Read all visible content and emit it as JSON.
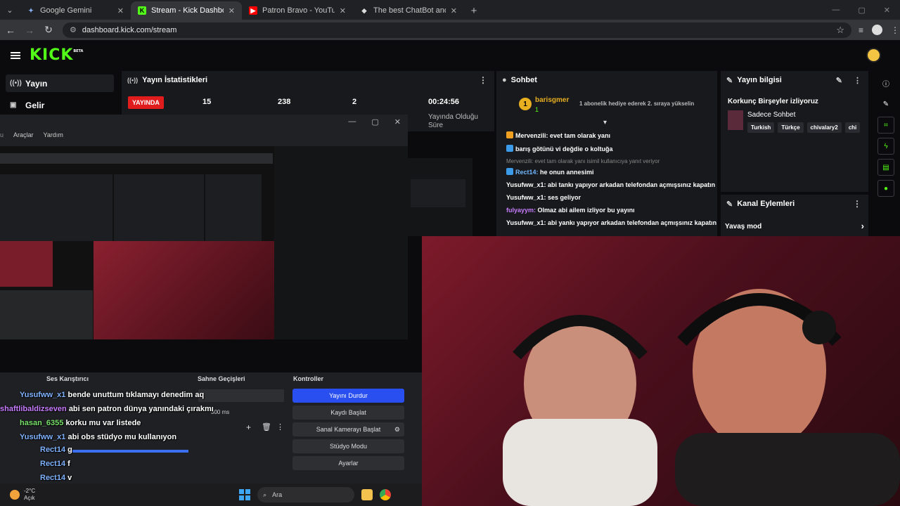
{
  "browser": {
    "tabs": [
      {
        "title": "Google Gemini",
        "active": false
      },
      {
        "title": "Stream - Kick Dashboard",
        "active": true
      },
      {
        "title": "Patron Bravo - YouTube",
        "active": false
      },
      {
        "title": "The best ChatBot and Widgets",
        "active": false
      }
    ],
    "url": "dashboard.kick.com/stream"
  },
  "kick": {
    "logo": "KICK",
    "logo_beta": "BETA",
    "sidebar": [
      {
        "label": "Yayın",
        "icon": "broadcast-icon"
      },
      {
        "label": "Gelir",
        "icon": "revenue-icon"
      }
    ]
  },
  "stats": {
    "title": "Yayın İstatistikleri",
    "live_label": "YAYINDA",
    "v1": "15",
    "v2": "238",
    "v3": "2",
    "duration": "00:24:56",
    "duration_label": "Yayında Olduğu Süre"
  },
  "chat": {
    "title": "Sohbet",
    "gifter": "barisgmer",
    "gifter_count": "1",
    "gift_msg": "1 abonelik hediye ederek 2. sıraya yükselin",
    "lines": [
      {
        "user": "Mervenzili",
        "text": "evet tam olarak yanı",
        "color": "#ffffff",
        "badge": "#f0a020"
      },
      {
        "user": "",
        "text": "barış götünü vi değdie o koltuğa",
        "color": "#e5484d",
        "badge": "#3b9be8"
      },
      {
        "user": "",
        "text": "Mervenzili: evet tam olarak yanı isimil kullanıcıya yanıt veriyor",
        "faint": true
      },
      {
        "user": "Rect14",
        "text": "he onun annesimi",
        "color": "#6fb7ff",
        "badge": "#3b9be8"
      },
      {
        "user": "Yusufww_x1",
        "text": "abi tankı yapıyor arkadan telefondan açmışsınız kapatın",
        "color": "#ffffff"
      },
      {
        "user": "Yusufww_x1",
        "text": "ses geliyor",
        "color": "#ffffff"
      },
      {
        "user": "fulyayym",
        "text": "Olmaz abi ailem izliyor bu yayını",
        "color": "#c77dff"
      },
      {
        "user": "Yusufww_x1",
        "text": "abi yankı yapıyor arkadan telefondan açmışsınız kapatın",
        "color": "#ffffff"
      }
    ]
  },
  "info": {
    "title": "Yayın bilgisi",
    "stream_title": "Korkunç Birşeyler izliyoruz",
    "category": "Sadece Sohbet",
    "tags": [
      "Turkish",
      "Türkçe",
      "chivalary2",
      "chi"
    ],
    "actions_title": "Kanal Eylemleri",
    "slow_mode": "Yavaş mod"
  },
  "obs": {
    "menu": [
      "Araçlar",
      "Yardım"
    ],
    "docks": {
      "mixer": "Ses Karıştırıcı",
      "transitions": "Sahne Geçişleri",
      "controls": "Kontroller",
      "transition_ms": "300 ms"
    },
    "buttons": [
      "Yayını Durdur",
      "Kaydı Başlat",
      "Sanal Kamerayı Başlat",
      "Stüdyo Modu",
      "Ayarlar"
    ]
  },
  "overlay_chat": [
    {
      "user": "Yusufww_x1",
      "text": "bende unuttum tıklamayı denedim aq"
    },
    {
      "user": "shaftlibaldizseven",
      "text": "abi sen patron dünya yanındaki çırakmı"
    },
    {
      "user": "hasan_6355",
      "text": "korku mu var listede"
    },
    {
      "user": "Yusufww_x1",
      "text": "abi obs stüdyo mu kullanıyon"
    },
    {
      "user": "Rect14",
      "text": "g"
    },
    {
      "user": "Rect14",
      "text": "f"
    },
    {
      "user": "Rect14",
      "text": "v"
    }
  ],
  "taskbar": {
    "temp": "-2°C",
    "weather": "Açık",
    "search": "Ara"
  }
}
